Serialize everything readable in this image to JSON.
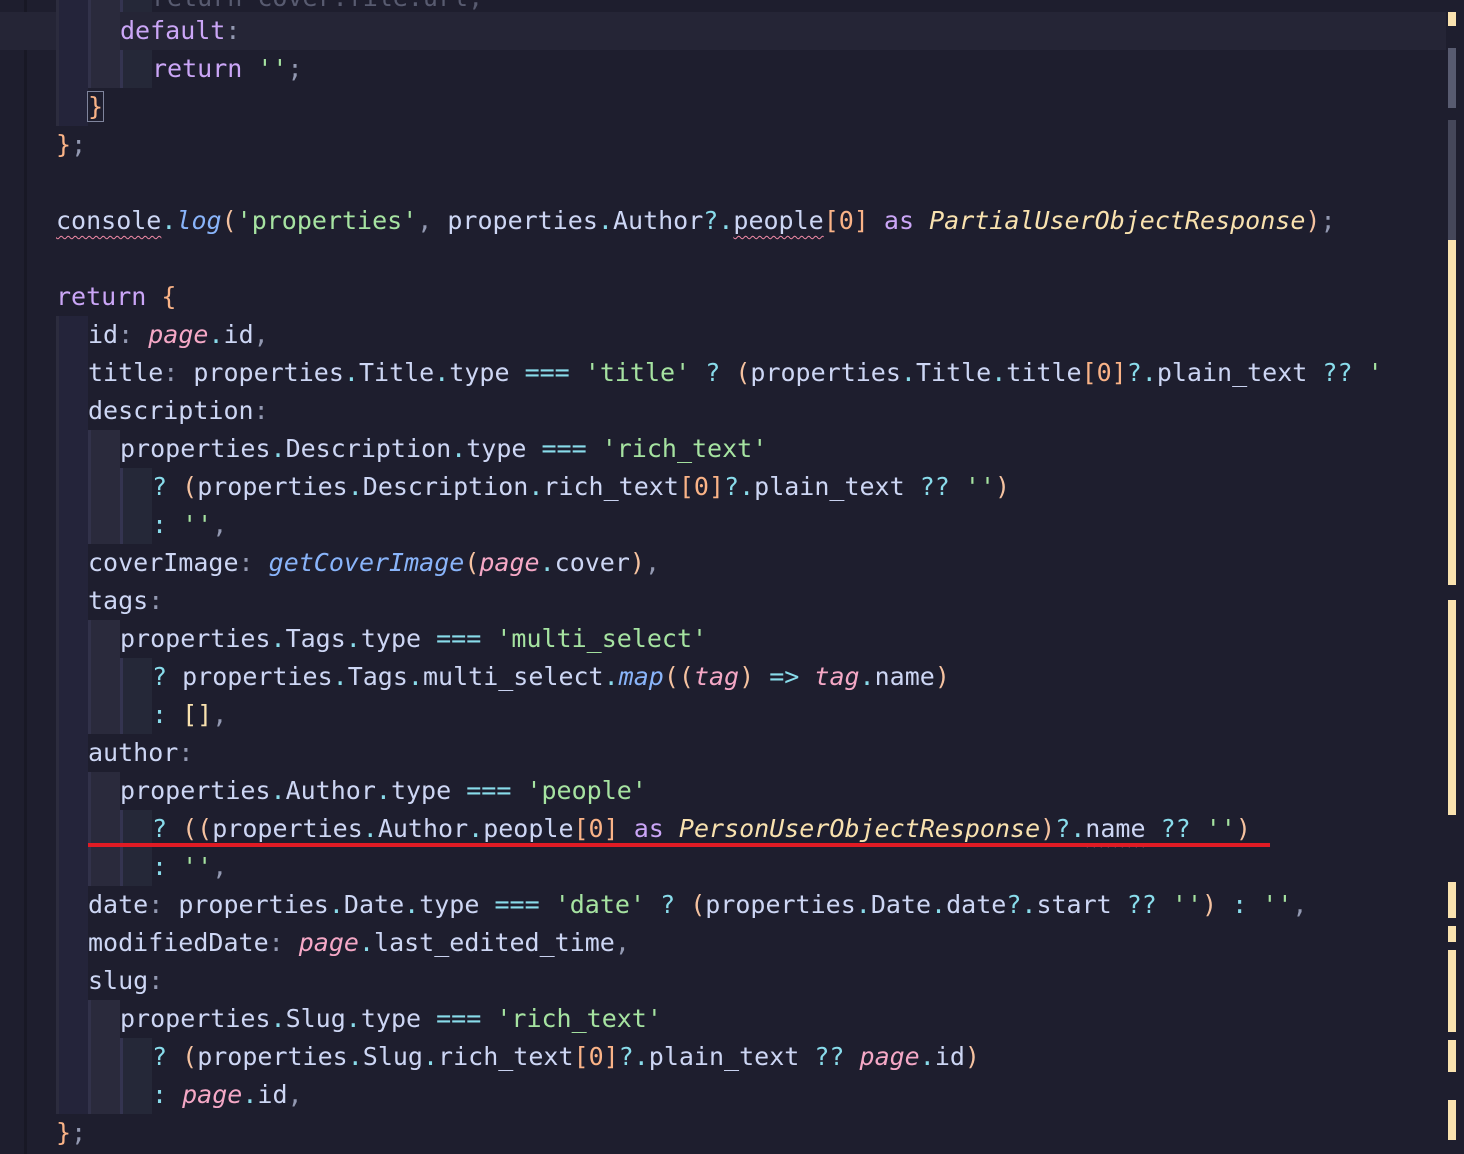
{
  "editor": {
    "language": "typescript",
    "theme_colors": {
      "background": "#1e1e2e",
      "keyword": "#cba6f7",
      "string": "#a6e3a1",
      "number": "#fab387",
      "operator": "#89dceb",
      "function": "#89b4fa",
      "parameter": "#f5a8c6",
      "type": "#f9e2af",
      "error_squiggle": "#f38ba8",
      "annotation_underline": "#e01b24"
    },
    "lines": [
      {
        "text": "return cover.file.url;"
      },
      {
        "text": "default:"
      },
      {
        "text": "return '';"
      },
      {
        "text": "}"
      },
      {
        "text": "};"
      },
      {
        "text": ""
      },
      {
        "text": "console.log('properties', properties.Author?.people[0] as PartialUserObjectResponse);"
      },
      {
        "text": ""
      },
      {
        "text": "return {"
      },
      {
        "text": "id: page.id,"
      },
      {
        "text": "title: properties.Title.type === 'title' ? (properties.Title.title[0]?.plain_text ?? '"
      },
      {
        "text": "description:"
      },
      {
        "text": "properties.Description.type === 'rich_text'"
      },
      {
        "text": "? (properties.Description.rich_text[0]?.plain_text ?? '')"
      },
      {
        "text": ": '',"
      },
      {
        "text": "coverImage: getCoverImage(page.cover),"
      },
      {
        "text": "tags:"
      },
      {
        "text": "properties.Tags.type === 'multi_select'"
      },
      {
        "text": "? properties.Tags.multi_select.map((tag) => tag.name)"
      },
      {
        "text": ": [],"
      },
      {
        "text": "author:"
      },
      {
        "text": "properties.Author.type === 'people'"
      },
      {
        "text": "? ((properties.Author.people[0] as PersonUserObjectResponse)?.name ?? '')"
      },
      {
        "text": ": '',"
      },
      {
        "text": "date: properties.Date.type === 'date' ? (properties.Date.date?.start ?? '') : '',"
      },
      {
        "text": "modifiedDate: page.last_edited_time,"
      },
      {
        "text": "slug:"
      },
      {
        "text": "properties.Slug.type === 'rich_text'"
      },
      {
        "text": "? (properties.Slug.rich_text[0]?.plain_text ?? page.id)"
      },
      {
        "text": ": page.id,"
      },
      {
        "text": "};"
      }
    ],
    "diagnostics": [
      {
        "kind": "error",
        "token": "console"
      },
      {
        "kind": "error",
        "token": "people"
      },
      {
        "kind": "error",
        "token": "name"
      }
    ],
    "highlighted_line_text": "? ((properties.Author.people[0] as PersonUserObjectResponse)?.name ?? '')"
  }
}
